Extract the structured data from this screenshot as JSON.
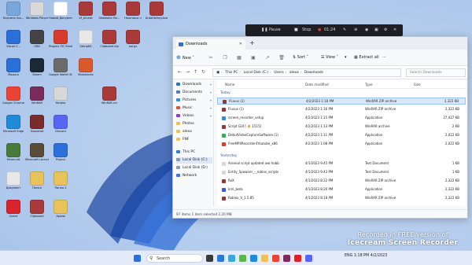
{
  "desktop": {
    "icons": [
      {
        "label": "Корзина (ba...",
        "color": "#7aa7d9"
      },
      {
        "label": "Windows Player",
        "color": "#d9d9d9"
      },
      {
        "label": "Новый Документ...",
        "color": "#ffffff"
      },
      {
        "label": "ef_all.exe",
        "color": "#a83a3a"
      },
      {
        "label": "Seaskalla Ski...",
        "color": "#a83a3a"
      },
      {
        "label": "Ножницы\nn",
        "color": "#a83a3a"
      },
      {
        "label": "AutoHotkey.Ava",
        "color": "#a83a3a"
      },
      {
        "label": "Setup64",
        "color": "#e8e8e8"
      },
      {
        "label": "Clipboard.zip",
        "color": "#a83a3a"
      },
      {
        "label": "sql.gz",
        "color": "#a83a3a"
      },
      {
        "label": "Visual C...",
        "color": "#2b6fd8"
      },
      {
        "label": "OBS",
        "color": "#444444"
      },
      {
        "label": "Яндекс ПС Studio",
        "color": "#d83a2b"
      },
      {
        "label": "Мышка",
        "color": "#2b6fd8"
      },
      {
        "label": "Steam",
        "color": "#1b2838"
      },
      {
        "label": "Google Wallet Studio",
        "color": "#6b6b6b"
      },
      {
        "label": "Bluestacks",
        "color": "#d85a2b"
      },
      {
        "label": "Google Chrome",
        "color": "#ea4335"
      },
      {
        "label": "WinRAR",
        "color": "#7a2b5a"
      },
      {
        "label": "Yandex",
        "color": "#d8d8d8"
      },
      {
        "label": "WinRAR.rar",
        "color": "#a83a3a"
      },
      {
        "label": "Microsoft Edge",
        "color": "#1f8ad8"
      },
      {
        "label": "Snapshot",
        "color": "#7a2b2b"
      },
      {
        "label": "Discord",
        "color": "#5865f2"
      },
      {
        "label": "Minecraft",
        "color": "#4a7a3a"
      },
      {
        "label": "Minecraft Launcher",
        "color": "#5a4a3a"
      },
      {
        "label": "Project",
        "color": "#2b6fd8"
      },
      {
        "label": "Документ",
        "color": "#e8e8e8"
      },
      {
        "label": "Папка",
        "color": "#e8c35a"
      },
      {
        "label": "Папка 2",
        "color": "#e8c35a"
      },
      {
        "label": "Opera",
        "color": "#d8232b"
      },
      {
        "label": "Clipboard",
        "color": "#a83a3a"
      },
      {
        "label": "Архив",
        "color": "#e8c35a"
      }
    ]
  },
  "recorder": {
    "pause_label": "Pause",
    "stop_label": "Stop",
    "timer": "01:24"
  },
  "explorer": {
    "tab_title": "Downloads",
    "toolbar": {
      "new_label": "New",
      "sort_label": "Sort",
      "view_label": "View",
      "extract_label": "Extract all"
    },
    "address": [
      "This PC",
      "Local Disk (C:)",
      "Users",
      "alexa",
      "Downloads"
    ],
    "search_placeholder": "Search Downloads",
    "nav": [
      {
        "label": "Downloads",
        "color": "#2f6fd1"
      },
      {
        "label": "Documents",
        "color": "#5a7ab5"
      },
      {
        "label": "Pictures",
        "color": "#3a8ad8"
      },
      {
        "label": "Music",
        "color": "#d85a3a"
      },
      {
        "label": "Videos",
        "color": "#8a3ad8"
      },
      {
        "label": "Photos",
        "color": "#e8c35a"
      },
      {
        "label": "alexa",
        "color": "#e8c35a"
      },
      {
        "label": "FNF",
        "color": "#e8c35a"
      },
      {
        "label": "This PC",
        "color": "#3a7ad8"
      },
      {
        "label": "Local Disk (C:)",
        "color": "#8a9aaa"
      },
      {
        "label": "Local Disk (D:)",
        "color": "#8a9aaa"
      },
      {
        "label": "Network",
        "color": "#3a7ad8"
      }
    ],
    "columns": {
      "name": "Name",
      "date": "Date modified",
      "type": "Type",
      "size": "Size"
    },
    "groups": {
      "today": "Today",
      "yesterday": "Yesterday"
    },
    "files_today": [
      {
        "name": "Fluxus (2)",
        "date": "4/2/2023 1:18 PM",
        "type": "WinRAR ZIP archive",
        "size": "2,322 KB",
        "color": "#8a3a3a"
      },
      {
        "name": "Fluxus (1)",
        "date": "4/2/2023 1:16 PM",
        "type": "WinRAR ZIP archive",
        "size": "2,322 KB",
        "color": "#8a3a3a"
      },
      {
        "name": "screen_recorder_setup",
        "date": "4/2/2023 1:15 PM",
        "type": "Application",
        "size": "27,427 KB",
        "color": "#3a8ad8"
      },
      {
        "name": "Script GUI [ 🔥 1515]",
        "date": "4/2/2023 1:13 PM",
        "type": "WinRAR archive",
        "size": "2 KB",
        "color": "#8a3a3a"
      },
      {
        "name": "DebutVideoCaptureSoftware (1)",
        "date": "4/2/2023 1:11 PM",
        "type": "Application",
        "size": "2,022 KB",
        "color": "#3aa85a"
      },
      {
        "name": "FreeMP4Recorder4Youtube_x86",
        "date": "4/2/2023 1:08 PM",
        "type": "Application",
        "size": "2,022 KB",
        "color": "#d83a3a"
      }
    ],
    "files_yesterday": [
      {
        "name": "Arsenal script updated owl hobb",
        "date": "4/1/2023 9:45 PM",
        "type": "Text Document",
        "size": "1 KB",
        "color": "#d8d8d8"
      },
      {
        "name": "Entity_Spawner_-_roblox_scripts",
        "date": "4/1/2023 9:43 PM",
        "type": "Text Document",
        "size": "1 KB",
        "color": "#d8d8d8"
      },
      {
        "name": "ReX",
        "date": "4/1/2023 8:22 PM",
        "type": "WinRAR ZIP archive",
        "size": "2,322 KB",
        "color": "#8a3a3a"
      },
      {
        "name": "krnl_beta",
        "date": "4/1/2023 8:20 PM",
        "type": "Application",
        "size": "2,322 KB",
        "color": "#3a5ad8"
      },
      {
        "name": "Roblox_V_1.5.85",
        "date": "4/1/2023 8:18 PM",
        "type": "WinRAR ZIP archive",
        "size": "2,322 KB",
        "color": "#8a3a3a"
      }
    ],
    "status": "97 items    1 item selected  2.20 MB"
  },
  "taskbar": {
    "search_label": "Search",
    "apps": [
      {
        "name": "start",
        "color": "#2f6fd1"
      },
      {
        "name": "app1",
        "color": "#3a3a3a"
      },
      {
        "name": "app2",
        "color": "#2b7ad8"
      },
      {
        "name": "app3",
        "color": "#3aa8d8"
      },
      {
        "name": "app4",
        "color": "#5ab84a"
      },
      {
        "name": "app5",
        "color": "#1f8ad8"
      },
      {
        "name": "app6",
        "color": "#e8c35a"
      },
      {
        "name": "app7",
        "color": "#ea4335"
      },
      {
        "name": "app8",
        "color": "#7a2b5a"
      },
      {
        "name": "app9",
        "color": "#d8232b"
      },
      {
        "name": "app10",
        "color": "#5865f2"
      }
    ],
    "tray": "ENG   1:18 PM  4/2/2023"
  },
  "watermark": {
    "line1": "Recorded in FREE version of",
    "line2": "Icecream  Screen  Recorder"
  }
}
